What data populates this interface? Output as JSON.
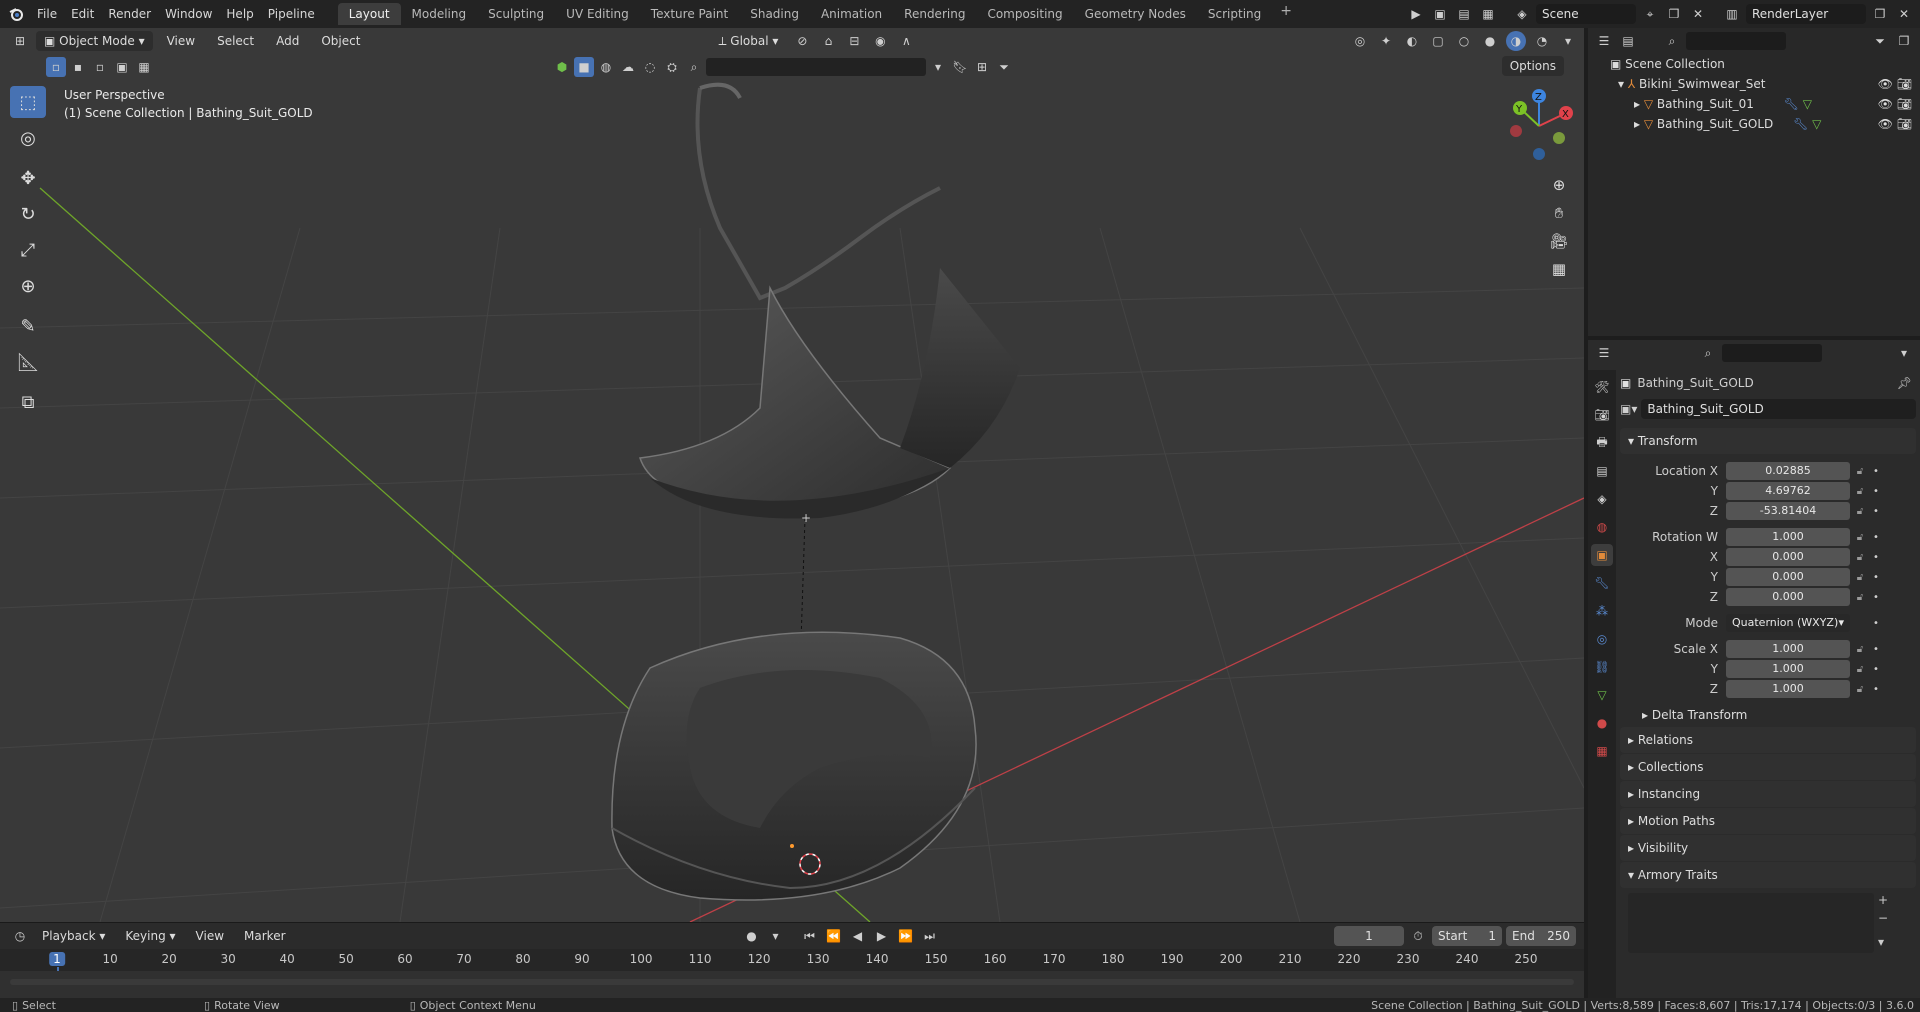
{
  "topbar": {
    "menus": [
      "File",
      "Edit",
      "Render",
      "Window",
      "Help",
      "Pipeline"
    ],
    "workspaces": [
      "Layout",
      "Modeling",
      "Sculpting",
      "UV Editing",
      "Texture Paint",
      "Shading",
      "Animation",
      "Rendering",
      "Compositing",
      "Geometry Nodes",
      "Scripting"
    ],
    "active_workspace": "Layout",
    "scene_name": "Scene",
    "view_layer": "RenderLayer"
  },
  "viewport": {
    "mode": "Object Mode",
    "menus": [
      "View",
      "Select",
      "Add",
      "Object"
    ],
    "orientation": "Global",
    "options_label": "Options",
    "perspective_label": "User Perspective",
    "collection_label": "(1) Scene Collection | Bathing_Suit_GOLD"
  },
  "outliner": {
    "root": "Scene Collection",
    "collection": "Bikini_Swimwear_Set",
    "objects": [
      "Bathing_Suit_01",
      "Bathing_Suit_GOLD"
    ]
  },
  "properties": {
    "object_name": "Bathing_Suit_GOLD",
    "datablock_name": "Bathing_Suit_GOLD",
    "transform_label": "Transform",
    "location": {
      "label": "Location X",
      "x": "0.02885",
      "y": "4.69762",
      "z": "-53.81404"
    },
    "rotation": {
      "label": "Rotation W",
      "w": "1.000",
      "x": "0.000",
      "y": "0.000",
      "z": "0.000"
    },
    "mode_label": "Mode",
    "mode_value": "Quaternion (WXYZ)",
    "scale": {
      "label": "Scale X",
      "x": "1.000",
      "y": "1.000",
      "z": "1.000"
    },
    "axis_y": "Y",
    "axis_z": "Z",
    "axis_x": "X",
    "delta_transform": "Delta Transform",
    "sections": [
      "Relations",
      "Collections",
      "Instancing",
      "Motion Paths",
      "Visibility"
    ],
    "armory_traits": "Armory Traits"
  },
  "timeline": {
    "menus": [
      "Playback",
      "Keying",
      "View",
      "Marker"
    ],
    "current_frame": "1",
    "start_label": "Start",
    "start_value": "1",
    "end_label": "End",
    "end_value": "250",
    "ticks": [
      "1",
      "10",
      "20",
      "30",
      "40",
      "50",
      "60",
      "70",
      "80",
      "90",
      "100",
      "110",
      "120",
      "130",
      "140",
      "150",
      "160",
      "170",
      "180",
      "190",
      "200",
      "210",
      "220",
      "230",
      "240",
      "250"
    ]
  },
  "statusbar": {
    "select": "Select",
    "rotate": "Rotate View",
    "context": "Object Context Menu",
    "stats": "Scene Collection | Bathing_Suit_GOLD | Verts:8,589 | Faces:8,607 | Tris:17,174 | Objects:0/3 | 3.6.0"
  },
  "colors": {
    "accent": "#4772b3",
    "x_axis": "#e0424b",
    "y_axis": "#7cc126",
    "z_axis": "#3d85e0"
  }
}
